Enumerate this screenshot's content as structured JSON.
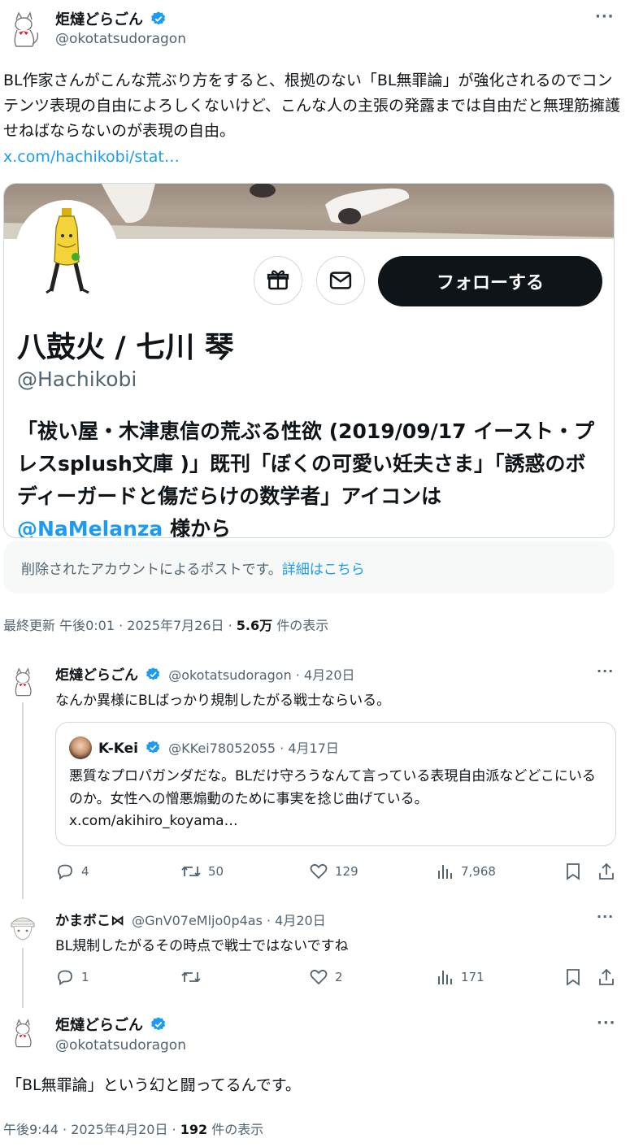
{
  "main_post": {
    "author_name": "炬燵どらごん",
    "author_handle": "@okotatsudoragon",
    "more_label": "···",
    "text": "BL作家さんがこんな荒ぶり方をすると、根拠のない「BL無罪論」が強化されるのでコンテンツ表現の自由によろしくないけど、こんな人の主張の発露までは自由だと無理筋擁護せねばならないのが表現の自由。",
    "link": "x.com/hachikobi/stat…"
  },
  "profile_card": {
    "display_name": "八鼓火 / 七川 琴",
    "handle": "@Hachikobi",
    "follow_label": "フォローする",
    "bio_text": "「祓い屋・木津恵信の荒ぶる性欲 (2019/09/17 イースト・プレスsplush文庫 )」既刊「ぼくの可愛い妊夫さま」「誘惑のボディーガードと傷だらけの数学者」アイコンは",
    "bio_mention": "@NaMelanza",
    "bio_tail": " 様から"
  },
  "deleted_notice": {
    "text": "削除されたアカウントによるポストです。",
    "link": "詳細はこちら"
  },
  "main_meta": {
    "prefix": "最終更新 午後0:01 · 2025年7月26日 · ",
    "views": "5.6万",
    "suffix": " 件の表示"
  },
  "reply1": {
    "author_name": "炬燵どらごん",
    "handle_date": "@okotatsudoragon · 4月20日",
    "text": "なんか異様にBLばっかり規制したがる戦士ならいる。",
    "quote": {
      "author_name": "K-Kei",
      "handle_date": "@KKei78052055 · 4月17日",
      "text": "悪質なプロパガンダだな。BLだけ守ろうなんて言っている表現自由派などどこにいるのか。女性への憎悪煽動のために事実を捻じ曲げている。",
      "link": "x.com/akihiro_koyama…"
    },
    "replies": "4",
    "reposts": "50",
    "likes": "129",
    "views": "7,968"
  },
  "reply2": {
    "author_name": "かまボこ⋈",
    "handle_date": "@GnV07eMljo0p4as · 4月20日",
    "text": "BL規制したがるその時点で戦士ではないですね",
    "replies": "1",
    "reposts": "",
    "likes": "2",
    "views": "171"
  },
  "reply3": {
    "author_name": "炬燵どらごん",
    "author_handle": "@okotatsudoragon",
    "text": "「BL無罪論」という幻と闘ってるんです。",
    "meta_prefix": "午後9:44 · 2025年4月20日 · ",
    "views": "192",
    "meta_suffix": " 件の表示"
  },
  "icons": [
    "verified-badge-icon",
    "more-icon",
    "gift-icon",
    "mail-icon",
    "reply-icon",
    "repost-icon",
    "like-icon",
    "views-icon",
    "bookmark-icon",
    "share-icon"
  ],
  "colors": {
    "accent": "#1d9bf0",
    "text": "#0f1419",
    "muted": "#536471",
    "border": "#cfd9de"
  }
}
